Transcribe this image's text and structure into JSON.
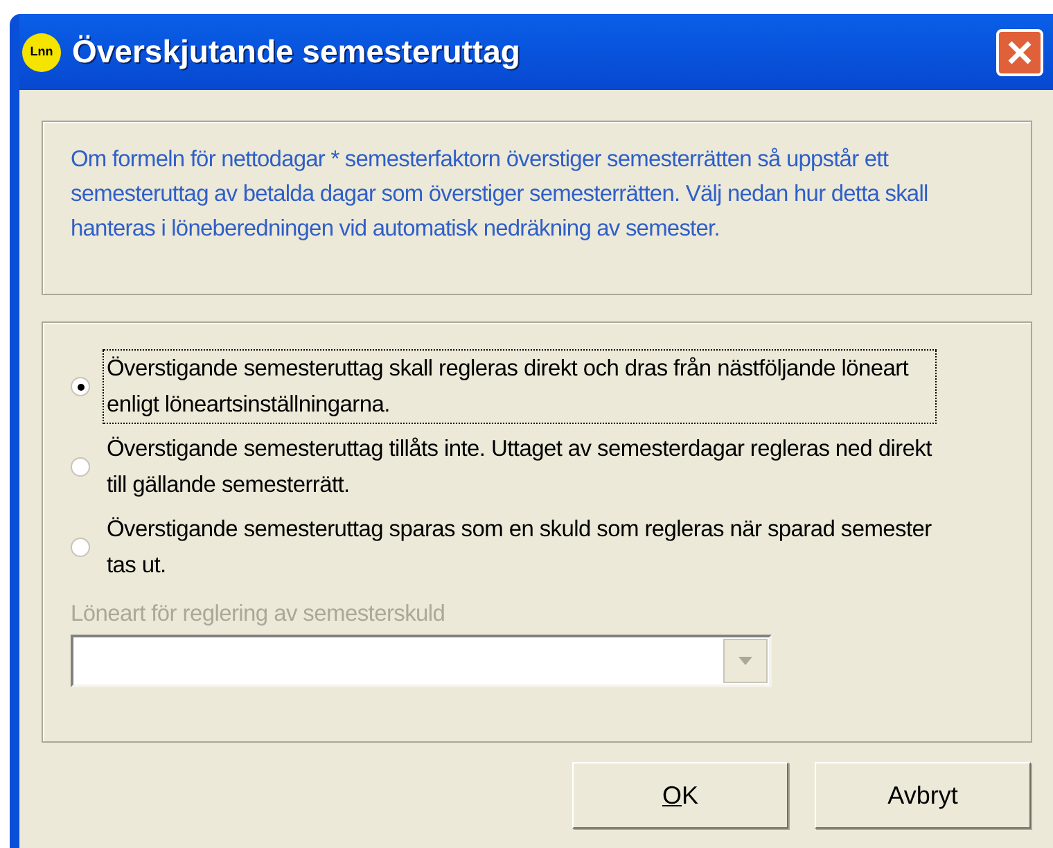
{
  "window": {
    "title": "Överskjutande semesteruttag",
    "icon_text": "Lnn"
  },
  "info_text": "Om formeln för nettodagar * semesterfaktorn överstiger semesterrätten så uppstår ett semesteruttag av betalda dagar som överstiger semesterrätten. Välj nedan hur detta skall hanteras i löneberedningen vid automatisk nedräkning av semester.",
  "options": [
    {
      "label": "Överstigande semesteruttag skall regleras direkt och dras från nästföljande löneart enligt löneartsinställningarna.",
      "selected": true
    },
    {
      "label": "Överstigande semesteruttag tillåts inte. Uttaget av semesterdagar regleras ned direkt till gällande semesterrätt.",
      "selected": false
    },
    {
      "label": "Överstigande semesteruttag sparas som en skuld som regleras när sparad semester tas ut.",
      "selected": false
    }
  ],
  "combo": {
    "label": "Löneart för reglering av semesterskuld",
    "disabled": true
  },
  "buttons": [
    {
      "label": "OK",
      "access_key_underlined": true
    },
    {
      "label": "Avbryt"
    }
  ]
}
